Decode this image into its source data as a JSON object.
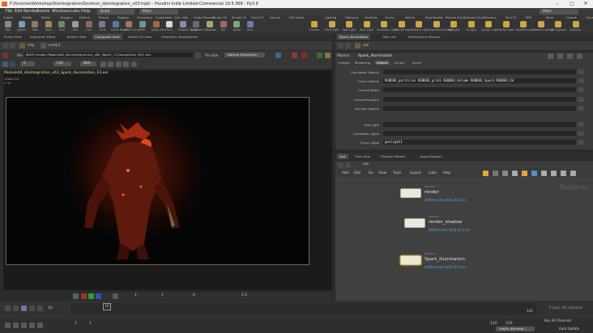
{
  "window": {
    "title": "F:/GnomonWorkshop/Disintegration/Gnomon_disintegration_v03.hiplc - Houdini Indie Limited-Commercial 19.5.368 - Py3.9",
    "controls": [
      "–",
      "□",
      "✕"
    ]
  },
  "menubar": {
    "items": [
      "File",
      "Edit",
      "Render",
      "Assets",
      "Windows",
      "Labs",
      "Help"
    ],
    "desktop": "Build",
    "network": "Main"
  },
  "shelf": {
    "tabs": [
      "Create",
      "Modify",
      "Model",
      "Polygon",
      "Deform",
      "Texture",
      "Rigging",
      "Characters",
      "Constraints",
      "Hair Utils",
      "Guide Process",
      "Terrain FX",
      "Simple FX",
      "Cloud FX",
      "Volume",
      "Edit Cable",
      "Lighting",
      "Collisions",
      "Particles",
      "Grains",
      "Vellum",
      "Rigid Bodies",
      "Particle Fluids",
      "Viscous Fluids",
      "Oceans",
      "Pyro FX",
      "FEM",
      "Wires",
      "Crowds",
      "Drive Simulation"
    ],
    "tools_left": [
      "Box",
      "Sphere",
      "Tube",
      "Torus",
      "Grid",
      "Null",
      "Line",
      "Circle",
      "Curve Bezier",
      "Draw Curve",
      "Path",
      "Spray Paint",
      "Font",
      "Platonic Solids",
      "L-System",
      "Metaball",
      "File",
      "Spiral",
      "Helix"
    ],
    "tools_right": [
      "Camera",
      "Point Light",
      "Spot Light",
      "Area Light",
      "Geometry Light",
      "Volume Light",
      "Distant Light",
      "Environment Light",
      "Sky Light",
      "GI Light",
      "Caustic Light",
      "Portal Light",
      "Ambient Light",
      "Stereo Camera",
      "VR Camera",
      "Switcher"
    ]
  },
  "left_tabs": [
    "Scene View",
    "Animation Editor",
    "Render View",
    "Composite View",
    "Motion FX View",
    "Geometry Spreadsheet"
  ],
  "left_path": [
    "img",
    "comp1"
  ],
  "viewer": {
    "file_label": "File",
    "file_path": "$HIP/render/Module04_disintegration_v03_Spark_illumination.$F4.exr",
    "file_size_label": "File Size",
    "resolution": "Natural Resolution",
    "channel": "C",
    "plane": "Full",
    "bits": "8bit",
    "image_name": "Module04_disintegration_v03_Spark_illumination_F4.exr",
    "res_text": "1280x720",
    "frame_text": "fr 15"
  },
  "right_tabs": [
    "Spark_illumination",
    "Take List",
    "Performance Monitor"
  ],
  "right_path": "out",
  "params": {
    "node_type": "Mantra",
    "node_name": "Spark_illumination",
    "tabs": [
      "Images",
      "Rendering",
      "Objects",
      "Scripts",
      "Driver"
    ],
    "fields": [
      {
        "label": "Candidate Objects",
        "value": ""
      },
      {
        "label": "Force Objects",
        "value": "RENDER_particles RENDER_grid1 RENDER_Volume RENDER_Spark RENDER_CH"
      },
      {
        "label": "Forced Matte",
        "value": ""
      },
      {
        "label": "Forced Phantom",
        "value": ""
      },
      {
        "label": "Exclude Objects",
        "value": ""
      },
      {
        "label": "Solo Light",
        "value": ""
      },
      {
        "label": "Candidate Lights",
        "value": ""
      },
      {
        "label": "Force Lights",
        "value": "geolight1"
      }
    ]
  },
  "net_tabs": [
    "/out",
    "Tree View",
    "Material Palette",
    "Asset Browser"
  ],
  "net_path": "out",
  "net_menu": [
    "Add",
    "Edit",
    "Go",
    "View",
    "Tools",
    "Layout",
    "Labs",
    "Help"
  ],
  "outputs_label": "Outputs",
  "nodes": [
    {
      "type": "Mantra",
      "name": "render",
      "path": "$HIP/render.$OS.$F4.exr"
    },
    {
      "type": "Mantra",
      "name": "render_shadow",
      "path": "$HIP/render.$OS.$F4.exr"
    },
    {
      "type": "Mantra",
      "name": "Spark_illumination",
      "path": "$HIP/render.$OS.$F4.exr"
    }
  ],
  "viewer_bottom": {
    "frame_a": "1",
    "frame_b": "1",
    "value": "0",
    "zoom": "2.2"
  },
  "playbar": {
    "current_frame": "10",
    "marker": "10",
    "ticks": [
      "120"
    ],
    "start": "1",
    "start2": "1",
    "end": "120",
    "end2": "120",
    "keys_label": "0 keys, 0/0 channels",
    "key_all": "Key All Channels",
    "update": "Auto Update",
    "obj": "/obj/fx_disintegr..."
  },
  "colors": {
    "accent": "#e8a33a",
    "node_path": "#4aa6d8",
    "render_border": "#6f6a47"
  }
}
